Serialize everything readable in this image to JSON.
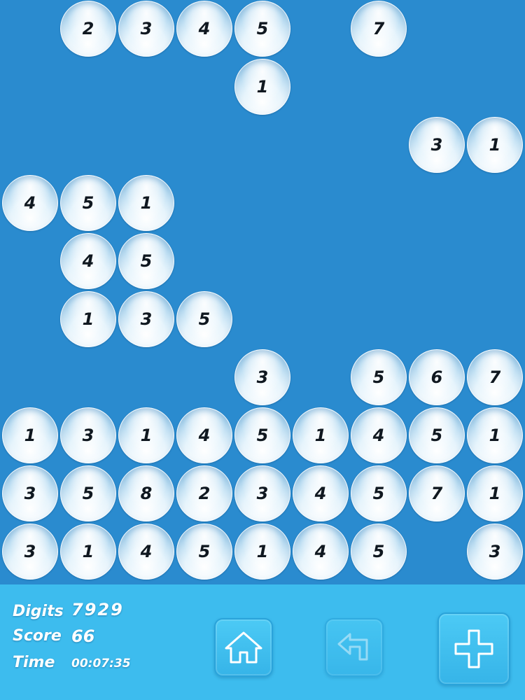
{
  "board": {
    "rows": [
      [
        null,
        "2",
        "3",
        "4",
        "5",
        null,
        "7",
        null,
        null
      ],
      [
        null,
        null,
        null,
        null,
        "1",
        null,
        null,
        null,
        null
      ],
      [
        null,
        null,
        null,
        null,
        null,
        null,
        null,
        "3",
        "1"
      ],
      [
        "4",
        "5",
        "1",
        null,
        null,
        null,
        null,
        null,
        null
      ],
      [
        null,
        "4",
        "5",
        null,
        null,
        null,
        null,
        null,
        null
      ],
      [
        null,
        "1",
        "3",
        "5",
        null,
        null,
        null,
        null,
        null
      ],
      [
        null,
        null,
        null,
        null,
        "3",
        null,
        "5",
        "6",
        "7"
      ],
      [
        "1",
        "3",
        "1",
        "4",
        "5",
        "1",
        "4",
        "5",
        "1"
      ],
      [
        "3",
        "5",
        "8",
        "2",
        "3",
        "4",
        "5",
        "7",
        "1"
      ],
      [
        "3",
        "1",
        "4",
        "5",
        "1",
        "4",
        "5",
        null,
        "3"
      ]
    ]
  },
  "stats": {
    "digits_label": "Digits",
    "digits_value": "7929",
    "score_label": "Score",
    "score_value": "66",
    "time_label": "Time",
    "time_value": "00:07:35"
  },
  "controls": {
    "home_icon": "home-icon",
    "back_icon": "undo-arrow-icon",
    "add_icon": "plus-icon",
    "back_enabled": false
  },
  "colors": {
    "board_background": "#2a8bcf",
    "footer_background": "#3dbcee",
    "digit_color": "#101820"
  }
}
